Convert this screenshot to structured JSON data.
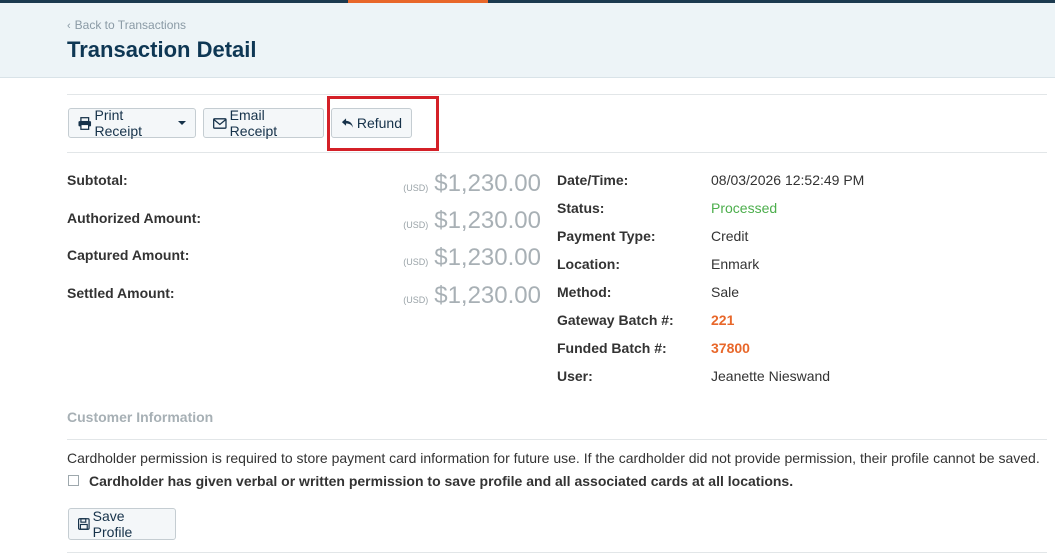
{
  "header": {
    "back_link": "Back to Transactions",
    "title": "Transaction Detail"
  },
  "toolbar": {
    "print_receipt": "Print Receipt",
    "email_receipt": "Email Receipt",
    "refund": "Refund"
  },
  "amounts": [
    {
      "label": "Subtotal:",
      "currency": "(USD)",
      "value": "$1,230.00"
    },
    {
      "label": "Authorized Amount:",
      "currency": "(USD)",
      "value": "$1,230.00"
    },
    {
      "label": "Captured Amount:",
      "currency": "(USD)",
      "value": "$1,230.00"
    },
    {
      "label": "Settled Amount:",
      "currency": "(USD)",
      "value": "$1,230.00"
    }
  ],
  "details": [
    {
      "label": "Date/Time:",
      "value": "08/03/2026 12:52:49 PM"
    },
    {
      "label": "Status:",
      "value": "Processed"
    },
    {
      "label": "Payment Type:",
      "value": "Credit"
    },
    {
      "label": "Location:",
      "value": "Enmark"
    },
    {
      "label": "Method:",
      "value": "Sale"
    },
    {
      "label": "Gateway Batch #:",
      "value": "221"
    },
    {
      "label": "Funded Batch #:",
      "value": "37800"
    },
    {
      "label": "User:",
      "value": "Jeanette Nieswand"
    }
  ],
  "customer": {
    "section_title": "Customer Information",
    "notice": "Cardholder permission is required to store payment card information for future use. If the cardholder did not provide permission, their profile cannot be saved.",
    "permission_label": "Cardholder has given verbal or written permission to save profile and all associated cards at all locations.",
    "save_profile": "Save Profile"
  },
  "colors": {
    "accent": "#e8672a",
    "brand": "#0e3754",
    "status_green": "#4cae4c",
    "highlight": "#d42027"
  }
}
